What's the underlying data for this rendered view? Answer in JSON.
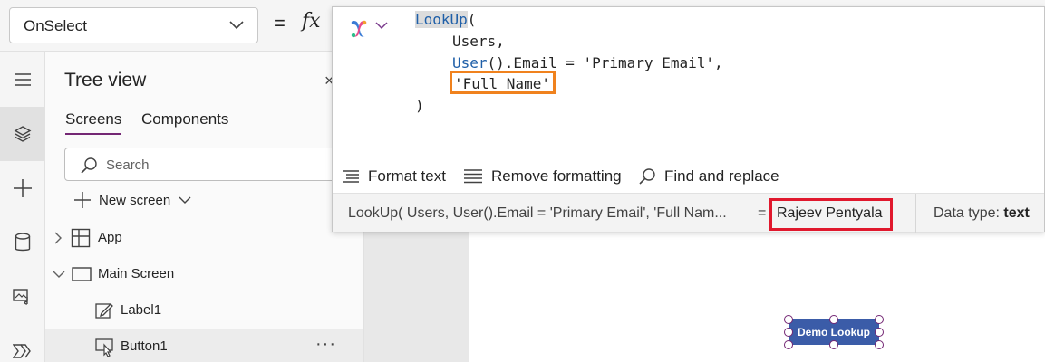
{
  "formula_bar": {
    "property": "OnSelect",
    "equals": "=",
    "fx": "fx"
  },
  "editor": {
    "lines": [
      "LookUp(",
      "Users,",
      "User().Email = 'Primary Email',",
      "'Full Name'",
      ")"
    ],
    "tokens": {
      "lookup": "LookUp",
      "paren_open": "(",
      "users": "Users,",
      "user_fn": "User",
      "email_rest": "().Email = 'Primary Email',",
      "full_name": "'Full Name'",
      "paren_close": ")"
    },
    "toolbar": {
      "format_text": "Format text",
      "remove_formatting": "Remove formatting",
      "find_replace": "Find and replace"
    },
    "result": {
      "expression": "LookUp( Users, User().Email = 'Primary Email', 'Full Nam...",
      "equals": "=",
      "value": "Rajeev Pentyala",
      "data_type_label": "Data type:",
      "data_type": "text"
    },
    "highlight_colors": {
      "formula_token": "#f0821e",
      "result_value": "#e0182d"
    }
  },
  "tree_view": {
    "title": "Tree view",
    "close": "×",
    "tabs": [
      "Screens",
      "Components"
    ],
    "search_placeholder": "Search",
    "new_screen": "New screen",
    "items": [
      {
        "label": "App"
      },
      {
        "label": "Main Screen"
      },
      {
        "label": "Label1"
      },
      {
        "label": "Button1",
        "more": "···"
      }
    ]
  },
  "canvas": {
    "button_label": "Demo Lookup",
    "button_color": "#3b5ca8"
  },
  "rail_icons": [
    "hamburger-icon",
    "layers-icon",
    "plus-icon",
    "database-icon",
    "media-icon",
    "power-automate-icon"
  ]
}
